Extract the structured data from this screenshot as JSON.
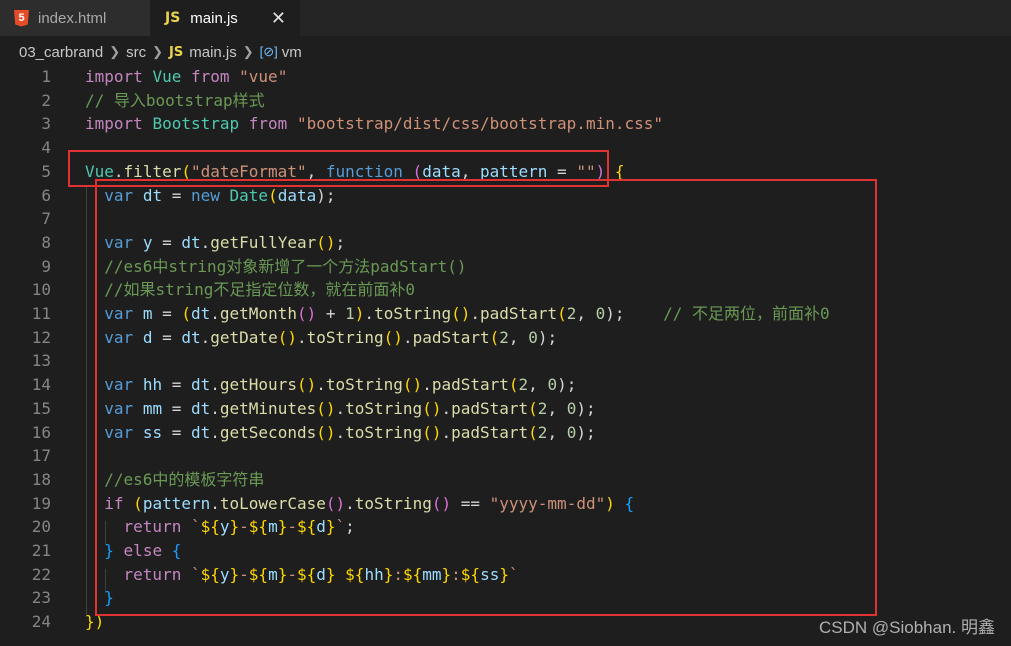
{
  "tabs": [
    {
      "icon": "html5-icon",
      "label": "index.html",
      "active": false
    },
    {
      "icon": "js-icon",
      "label": "main.js",
      "active": true
    }
  ],
  "breadcrumb": {
    "items": [
      "03_carbrand",
      "src",
      "main.js",
      "vm"
    ],
    "js_icon_text": "JS",
    "html_icon_text": "5"
  },
  "editor": {
    "line_numbers": [
      "1",
      "2",
      "3",
      "4",
      "5",
      "6",
      "7",
      "8",
      "9",
      "10",
      "11",
      "12",
      "13",
      "14",
      "15",
      "16",
      "17",
      "18",
      "19",
      "20",
      "21",
      "22",
      "23",
      "24"
    ],
    "lines": {
      "l1": [
        "import",
        " ",
        "Vue",
        " ",
        "from",
        " ",
        "\"vue\""
      ],
      "l2": [
        "// 导入bootstrap样式"
      ],
      "l3": [
        "import",
        " ",
        "Bootstrap",
        " ",
        "from",
        " ",
        "\"bootstrap/dist/css/bootstrap.min.css\""
      ],
      "l5": [
        "Vue",
        ".",
        "filter",
        "(",
        "\"dateFormat\"",
        ", ",
        "function",
        " ",
        "(",
        "data",
        ", ",
        "pattern",
        " = ",
        "\"\"",
        ")",
        " ",
        "{"
      ],
      "l6": [
        "  ",
        "var",
        " ",
        "dt",
        " = ",
        "new",
        " ",
        "Date",
        "(",
        "data",
        ");"
      ],
      "l8": [
        "  ",
        "var",
        " ",
        "y",
        " = ",
        "dt",
        ".",
        "getFullYear",
        "()",
        ";"
      ],
      "l9": [
        "  ",
        "//es6中string对象新增了一个方法padStart()"
      ],
      "l10": [
        "  ",
        "//如果string不足指定位数，就在前面补0"
      ],
      "l11": [
        "  ",
        "var",
        " ",
        "m",
        " = ",
        "(",
        "dt",
        ".",
        "getMonth",
        "()",
        " + ",
        "1",
        ")",
        ".",
        "toString",
        "()",
        ".",
        "padStart",
        "(",
        "2",
        ", ",
        "0",
        ");",
        "    ",
        "// 不足两位，前面补0"
      ],
      "l12": [
        "  ",
        "var",
        " ",
        "d",
        " = ",
        "dt",
        ".",
        "getDate",
        "()",
        ".",
        "toString",
        "()",
        ".",
        "padStart",
        "(",
        "2",
        ", ",
        "0",
        ");"
      ],
      "l14": [
        "  ",
        "var",
        " ",
        "hh",
        " = ",
        "dt",
        ".",
        "getHours",
        "()",
        ".",
        "toString",
        "()",
        ".",
        "padStart",
        "(",
        "2",
        ", ",
        "0",
        ");"
      ],
      "l15": [
        "  ",
        "var",
        " ",
        "mm",
        " = ",
        "dt",
        ".",
        "getMinutes",
        "()",
        ".",
        "toString",
        "()",
        ".",
        "padStart",
        "(",
        "2",
        ", ",
        "0",
        ");"
      ],
      "l16": [
        "  ",
        "var",
        " ",
        "ss",
        " = ",
        "dt",
        ".",
        "getSeconds",
        "()",
        ".",
        "toString",
        "()",
        ".",
        "padStart",
        "(",
        "2",
        ", ",
        "0",
        ");"
      ],
      "l18": [
        "  ",
        "//es6中的模板字符串"
      ],
      "l19": [
        "  ",
        "if",
        " ",
        "(",
        "pattern",
        ".",
        "toLowerCase",
        "()",
        ".",
        "toString",
        "()",
        " == ",
        "\"yyyy-mm-dd\"",
        ")",
        " ",
        "{"
      ],
      "l20": [
        "    ",
        "return",
        " ",
        "`",
        "${",
        "y",
        "}",
        "-",
        "${",
        "m",
        "}",
        "-",
        "${",
        "d",
        "}",
        "`",
        ";"
      ],
      "l21": [
        "  ",
        "}",
        " ",
        "else",
        " ",
        "{"
      ],
      "l22": [
        "    ",
        "return",
        " ",
        "`",
        "${",
        "y",
        "}",
        "-",
        "${",
        "m",
        "}",
        "-",
        "${",
        "d",
        "}",
        " ",
        "${",
        "hh",
        "}",
        ":",
        "${",
        "mm",
        "}",
        ":",
        "${",
        "ss",
        "}",
        "`"
      ],
      "l23": [
        "  ",
        "}"
      ],
      "l24": [
        "})"
      ]
    }
  },
  "watermark": "CSDN @Siobhan. 明鑫",
  "colors": {
    "highlight_box": "#e03232",
    "keyword": "#569cd6",
    "string": "#ce9178",
    "comment": "#6a9955"
  }
}
